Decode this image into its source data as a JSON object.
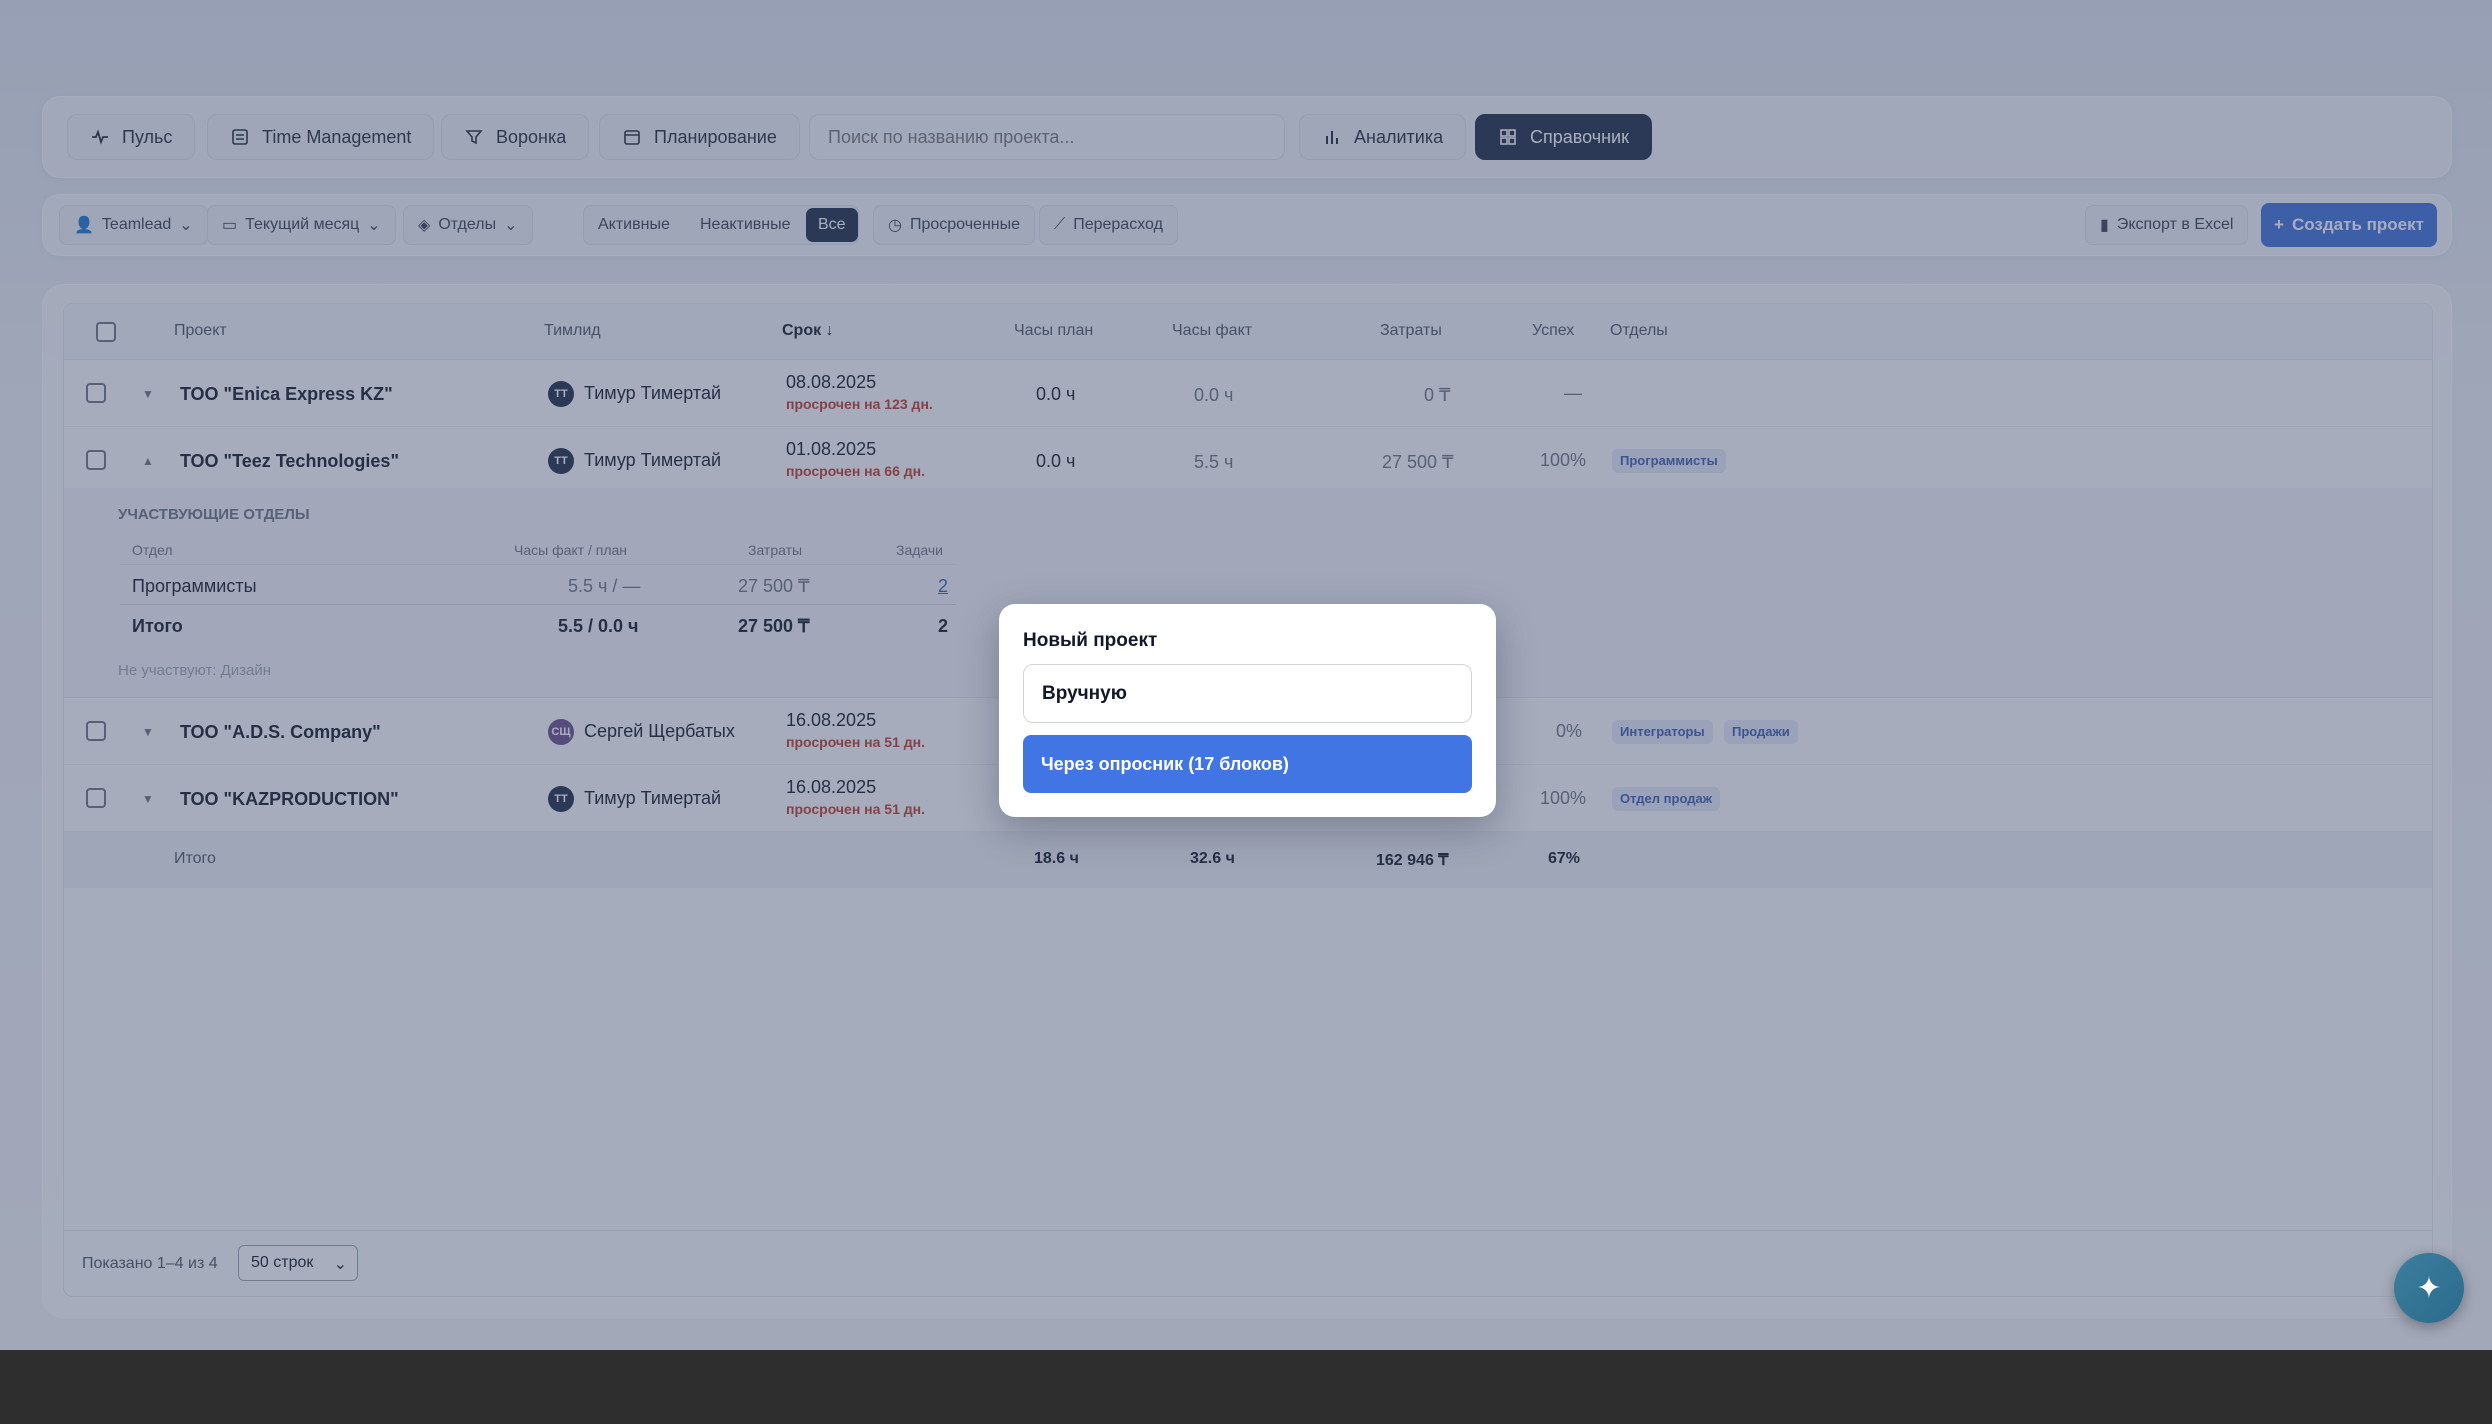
{
  "nav": {
    "items": [
      {
        "label": "Пульс",
        "icon": "pulse-icon"
      },
      {
        "label": "Time Management",
        "icon": "document-icon"
      },
      {
        "label": "Воронка",
        "icon": "funnel-icon"
      },
      {
        "label": "Планирование",
        "icon": "calendar-icon"
      }
    ],
    "search_placeholder": "Поиск по названию проекта...",
    "analytics": "Аналитика",
    "directory": "Справочник"
  },
  "filters": {
    "teamlead": "Teamlead",
    "period": "Текущий месяц",
    "departments": "Отделы",
    "seg_active": "Активные",
    "seg_inactive": "Неактивные",
    "seg_all": "Все",
    "overdue": "Просроченные",
    "overspend": "Перерасход",
    "export": "Экспорт в Excel",
    "create": "Создать проект"
  },
  "table": {
    "headers": {
      "project": "Проект",
      "lead": "Тимлид",
      "deadline": "Срок ↓",
      "hours_plan": "Часы план",
      "hours_fact": "Часы факт",
      "cost": "Затраты",
      "success": "Успех",
      "departments": "Отделы"
    },
    "rows": [
      {
        "name": "ТОО \"Enica Express KZ\"",
        "caret": "▼",
        "initials": "ТТ",
        "lead": "Тимур Тимертай",
        "date": "08.08.2025",
        "overdue": "просрочен на 123 дн.",
        "plan": "0.0 ч",
        "fact": "0.0 ч",
        "cost": "0 ₸",
        "success": "—",
        "tags": []
      },
      {
        "name": "ТОО \"Teez Technologies\"",
        "caret": "▲",
        "initials": "ТТ",
        "lead": "Тимур Тимертай",
        "date": "01.08.2025",
        "overdue": "просрочен на 66 дн.",
        "plan": "0.0 ч",
        "fact": "5.5 ч",
        "cost": "27 500 ₸",
        "success": "100%",
        "tags": [
          "Программисты"
        ]
      },
      {
        "name": "ТОО \"A.D.S. Company\"",
        "caret": "▼",
        "initials": "СЩ",
        "lead": "Сергей Щербатых",
        "date": "16.08.2025",
        "overdue": "просрочен на 51 дн.",
        "plan": "",
        "fact": "",
        "cost": "",
        "success": "0%",
        "tags": [
          "Интеграторы",
          "Продажи"
        ]
      },
      {
        "name": "ТОО \"KAZPRODUCTION\"",
        "caret": "▼",
        "initials": "ТТ",
        "lead": "Тимур Тимертай",
        "date": "16.08.2025",
        "overdue": "просрочен на 51 дн.",
        "plan": "",
        "fact": "",
        "cost": "",
        "success": "100%",
        "tags": [
          "Отдел продаж"
        ]
      }
    ],
    "expanded": {
      "title": "УЧАСТВУЮЩИЕ ОТДЕЛЫ",
      "headers": {
        "dept": "Отдел",
        "hours": "Часы факт / план",
        "cost": "Затраты",
        "tasks": "Задачи"
      },
      "row": {
        "dept": "Программисты",
        "hours": "5.5 ч / —",
        "cost": "27 500 ₸",
        "tasks": "2"
      },
      "total": {
        "label": "Итого",
        "hours": "5.5 / 0.0 ч",
        "cost": "27 500 ₸",
        "tasks": "2"
      },
      "not_participating": "Не участвуют: Дизайн"
    },
    "total": {
      "label": "Итого",
      "plan": "18.6 ч",
      "fact": "32.6 ч",
      "cost": "162 946 ₸",
      "success": "67%"
    },
    "footer": {
      "shown": "Показано 1–4 из 4",
      "page_size": "50 строк"
    }
  },
  "modal": {
    "title": "Новый проект",
    "option_manual": "Вручную",
    "option_survey": "Через опросник (17 блоков)"
  },
  "colors": {
    "accent": "#4075e3",
    "dark": "#1e2a44",
    "danger": "#c0392b"
  }
}
